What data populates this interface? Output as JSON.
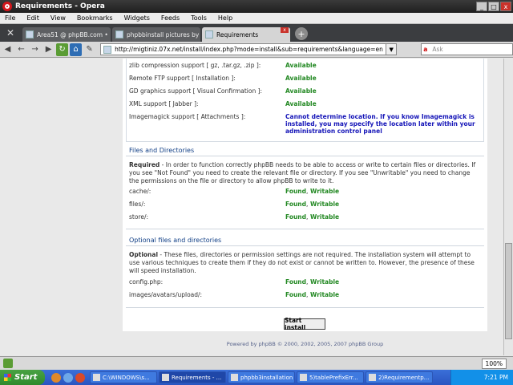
{
  "window": {
    "title": "Requirements - Opera",
    "controls": [
      "_",
      "□",
      "x"
    ]
  },
  "menu": [
    "File",
    "Edit",
    "View",
    "Bookmarks",
    "Widgets",
    "Feeds",
    "Tools",
    "Help"
  ],
  "tabs": [
    {
      "label": "Area51 @ phpBB.com • ...",
      "active": false
    },
    {
      "label": "phpbbinstall pictures by ...",
      "active": false
    },
    {
      "label": "Requirements",
      "active": true
    }
  ],
  "address": {
    "url": "http://migtiniz.07x.net/install/index.php?mode=install&sub=requirements&language=en",
    "search_placeholder": "Ask",
    "search_engine": "Ask"
  },
  "php_settings": [
    {
      "label": "zlib compression support [ gz, .tar.gz, .zip ]:",
      "value": "Available"
    },
    {
      "label": "Remote FTP support [ Installation ]:",
      "value": "Available"
    },
    {
      "label": "GD graphics support [ Visual Confirmation ]:",
      "value": "Available"
    },
    {
      "label": "XML support [ Jabber ]:",
      "value": "Available"
    },
    {
      "label": "Imagemagick support [ Attachments ]:",
      "value": "Cannot determine location. If you know Imagemagick is installed, you may specify the location later within your administration control panel"
    }
  ],
  "files_section": {
    "title": "Files and Directories",
    "intro_bold": "Required",
    "intro": " - In order to function correctly phpBB needs to be able to access or write to certain files or directories. If you see \"Not Found\" you need to create the relevant file or directory. If you see \"Unwritable\" you need to change the permissions on the file or directory to allow phpBB to write to it.",
    "items": [
      {
        "label": "cache/:",
        "found": "Found",
        "writable": "Writable"
      },
      {
        "label": "files/:",
        "found": "Found",
        "writable": "Writable"
      },
      {
        "label": "store/:",
        "found": "Found",
        "writable": "Writable"
      }
    ]
  },
  "optional_section": {
    "title": "Optional files and directories",
    "intro_bold": "Optional",
    "intro": " - These files, directories or permission settings are not required. The installation system will attempt to use various techniques to create them if they do not exist or cannot be written to. However, the presence of these will speed installation.",
    "items": [
      {
        "label": "config.php:",
        "found": "Found",
        "writable": "Writable"
      },
      {
        "label": "images/avatars/upload/:",
        "found": "Found",
        "writable": "Writable"
      }
    ]
  },
  "separator": ",",
  "start_button": "Start install",
  "footer": "Powered by phpBB © 2000, 2002, 2005, 2007 phpBB Group",
  "status": {
    "zoom": "100%"
  },
  "taskbar": {
    "start": "Start",
    "buttons": [
      {
        "label": "C:\\WINDOWS\\s...",
        "active": false
      },
      {
        "label": "Requirements - ...",
        "active": true
      },
      {
        "label": "phpbb3installation",
        "active": false
      },
      {
        "label": "5)tablePrefixErr...",
        "active": false
      },
      {
        "label": "2)Requirementp...",
        "active": false
      }
    ],
    "clock": "7:21 PM"
  },
  "colors": {
    "available": "#228822",
    "warning": "#1515b8",
    "section_title": "#113f86"
  }
}
